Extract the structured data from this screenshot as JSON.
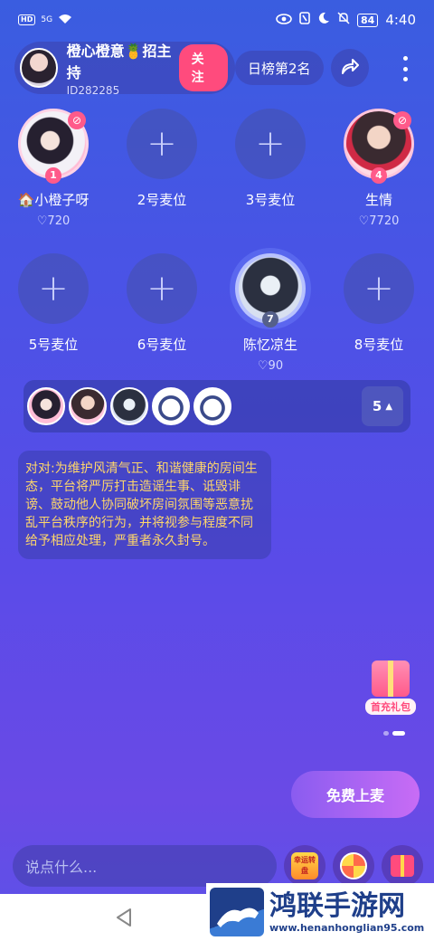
{
  "status_bar": {
    "hd": "HD",
    "signal": "5G",
    "battery": "84",
    "time": "4:40"
  },
  "host": {
    "name": "橙心橙意🍍招主持",
    "id": "ID282285",
    "follow_label": "关注"
  },
  "rank_label": "日榜第2名",
  "seats": [
    {
      "name": "🏠小橙子呀",
      "likes": "♡720",
      "number": "1"
    },
    {
      "name": "2号麦位"
    },
    {
      "name": "3号麦位"
    },
    {
      "name": "生情",
      "likes": "♡7720",
      "number": "4"
    },
    {
      "name": "5号麦位"
    },
    {
      "name": "6号麦位"
    },
    {
      "name": "陈忆凉生",
      "likes": "♡90",
      "number": "7"
    },
    {
      "name": "8号麦位"
    }
  ],
  "audience": {
    "count": "5",
    "arrow": "▲"
  },
  "notice": "对对:为维护风清气正、和谐健康的房间生态，平台将严厉打击造谣生事、诋毁诽谤、鼓动他人协同破坏房间氛围等恶意扰乱平台秩序的行为，并将视参与程度不同给予相应处理，严重者永久封号。",
  "gift_pack_label": "首充礼包",
  "mic_button": "免费上麦",
  "chat_placeholder": "说点什么...",
  "luck_wheel_label": "幸运转盘",
  "watermark": {
    "title": "鸿联手游网",
    "url": "www.henanhonglian95.com"
  }
}
